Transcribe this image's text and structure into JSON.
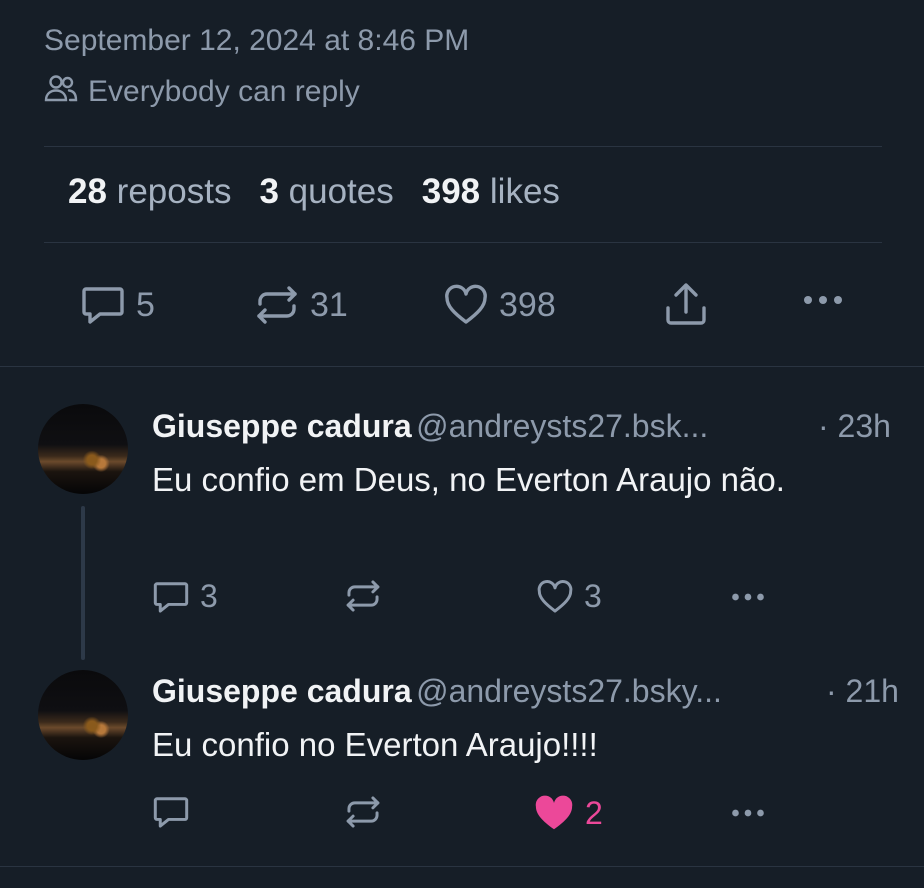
{
  "post": {
    "timestamp": "September 12, 2024 at 8:46 PM",
    "reply_setting": "Everybody can reply",
    "stats": {
      "reposts_count": "28",
      "reposts_label": "reposts",
      "quotes_count": "3",
      "quotes_label": "quotes",
      "likes_count": "398",
      "likes_label": "likes"
    },
    "actions": {
      "reply_count": "5",
      "repost_count": "31",
      "like_count": "398"
    }
  },
  "replies": [
    {
      "name": "Giuseppe cadura",
      "handle": "@andreysts27.bsk...",
      "time": "· 23h",
      "text": "Eu confio em Deus, no Everton Araujo não.",
      "reply_count": "3",
      "repost_count": "",
      "like_count": "3",
      "liked": false
    },
    {
      "name": "Giuseppe cadura",
      "handle": "@andreysts27.bsky...",
      "time": "· 21h",
      "text": "Eu confio no Everton Araujo!!!!",
      "reply_count": "",
      "repost_count": "",
      "like_count": "2",
      "liked": true
    }
  ],
  "colors": {
    "background": "#161e27",
    "muted": "#8d9aab",
    "divider": "#2a3441",
    "like_active": "#ec4899"
  }
}
